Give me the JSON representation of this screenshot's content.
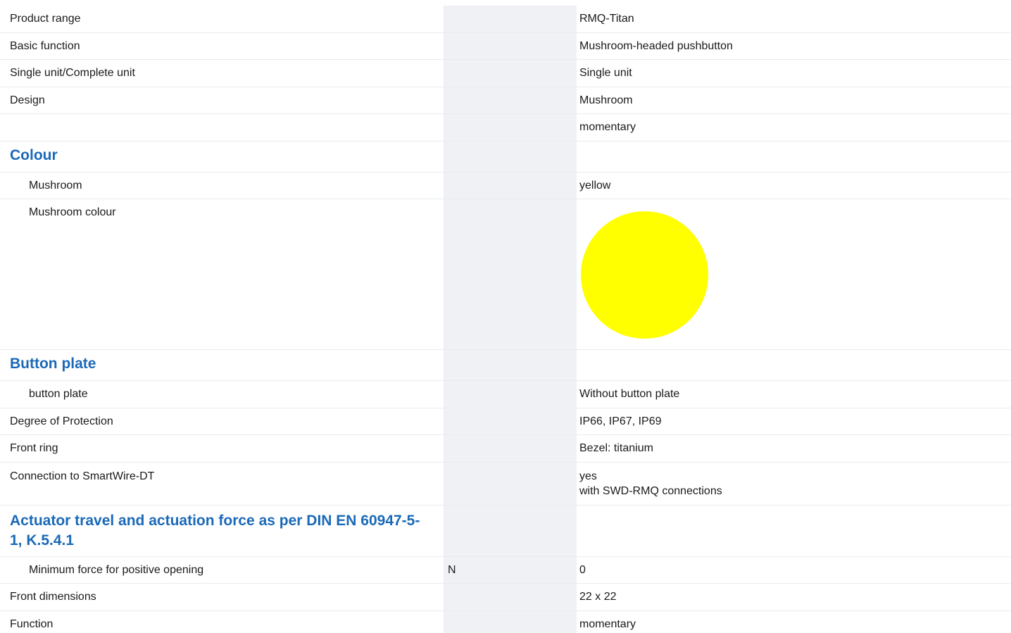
{
  "colors": {
    "heading": "#1a69b8",
    "shade": "#eff1f5",
    "mushroom_swatch": "#ffff00"
  },
  "rows": {
    "product_range": {
      "label": "Product range",
      "unit": "",
      "value": "RMQ-Titan"
    },
    "basic_function": {
      "label": "Basic function",
      "unit": "",
      "value": "Mushroom-headed pushbutton"
    },
    "single_unit": {
      "label": "Single unit/Complete unit",
      "unit": "",
      "value": "Single unit"
    },
    "design": {
      "label": "Design",
      "unit": "",
      "value": "Mushroom"
    },
    "design_extra": {
      "label": "",
      "unit": "",
      "value": "momentary"
    },
    "colour_section": {
      "label": "Colour"
    },
    "mushroom": {
      "label": "Mushroom",
      "unit": "",
      "value": "yellow"
    },
    "mushroom_colour": {
      "label": "Mushroom colour",
      "swatch_icon": "yellow-circle-swatch"
    },
    "button_plate_section": {
      "label": "Button plate"
    },
    "button_plate": {
      "label": "button plate",
      "unit": "",
      "value": "Without button plate"
    },
    "degree_of_protection": {
      "label": "Degree of Protection",
      "unit": "",
      "value": "IP66, IP67, IP69"
    },
    "front_ring": {
      "label": "Front ring",
      "unit": "",
      "value": "Bezel: titanium"
    },
    "smartwire": {
      "label": "Connection to SmartWire-DT",
      "unit": "",
      "value_line1": "yes",
      "value_line2": "with SWD-RMQ connections"
    },
    "actuator_section": {
      "label": "Actuator travel and actuation force as per DIN EN 60947-5-1, K.5.4.1"
    },
    "min_force": {
      "label": "Minimum force for positive opening",
      "unit": "N",
      "value": "0"
    },
    "front_dimensions": {
      "label": "Front dimensions",
      "unit": "",
      "value": "22 x 22"
    },
    "function": {
      "label": "Function",
      "unit": "",
      "value": "momentary"
    }
  }
}
